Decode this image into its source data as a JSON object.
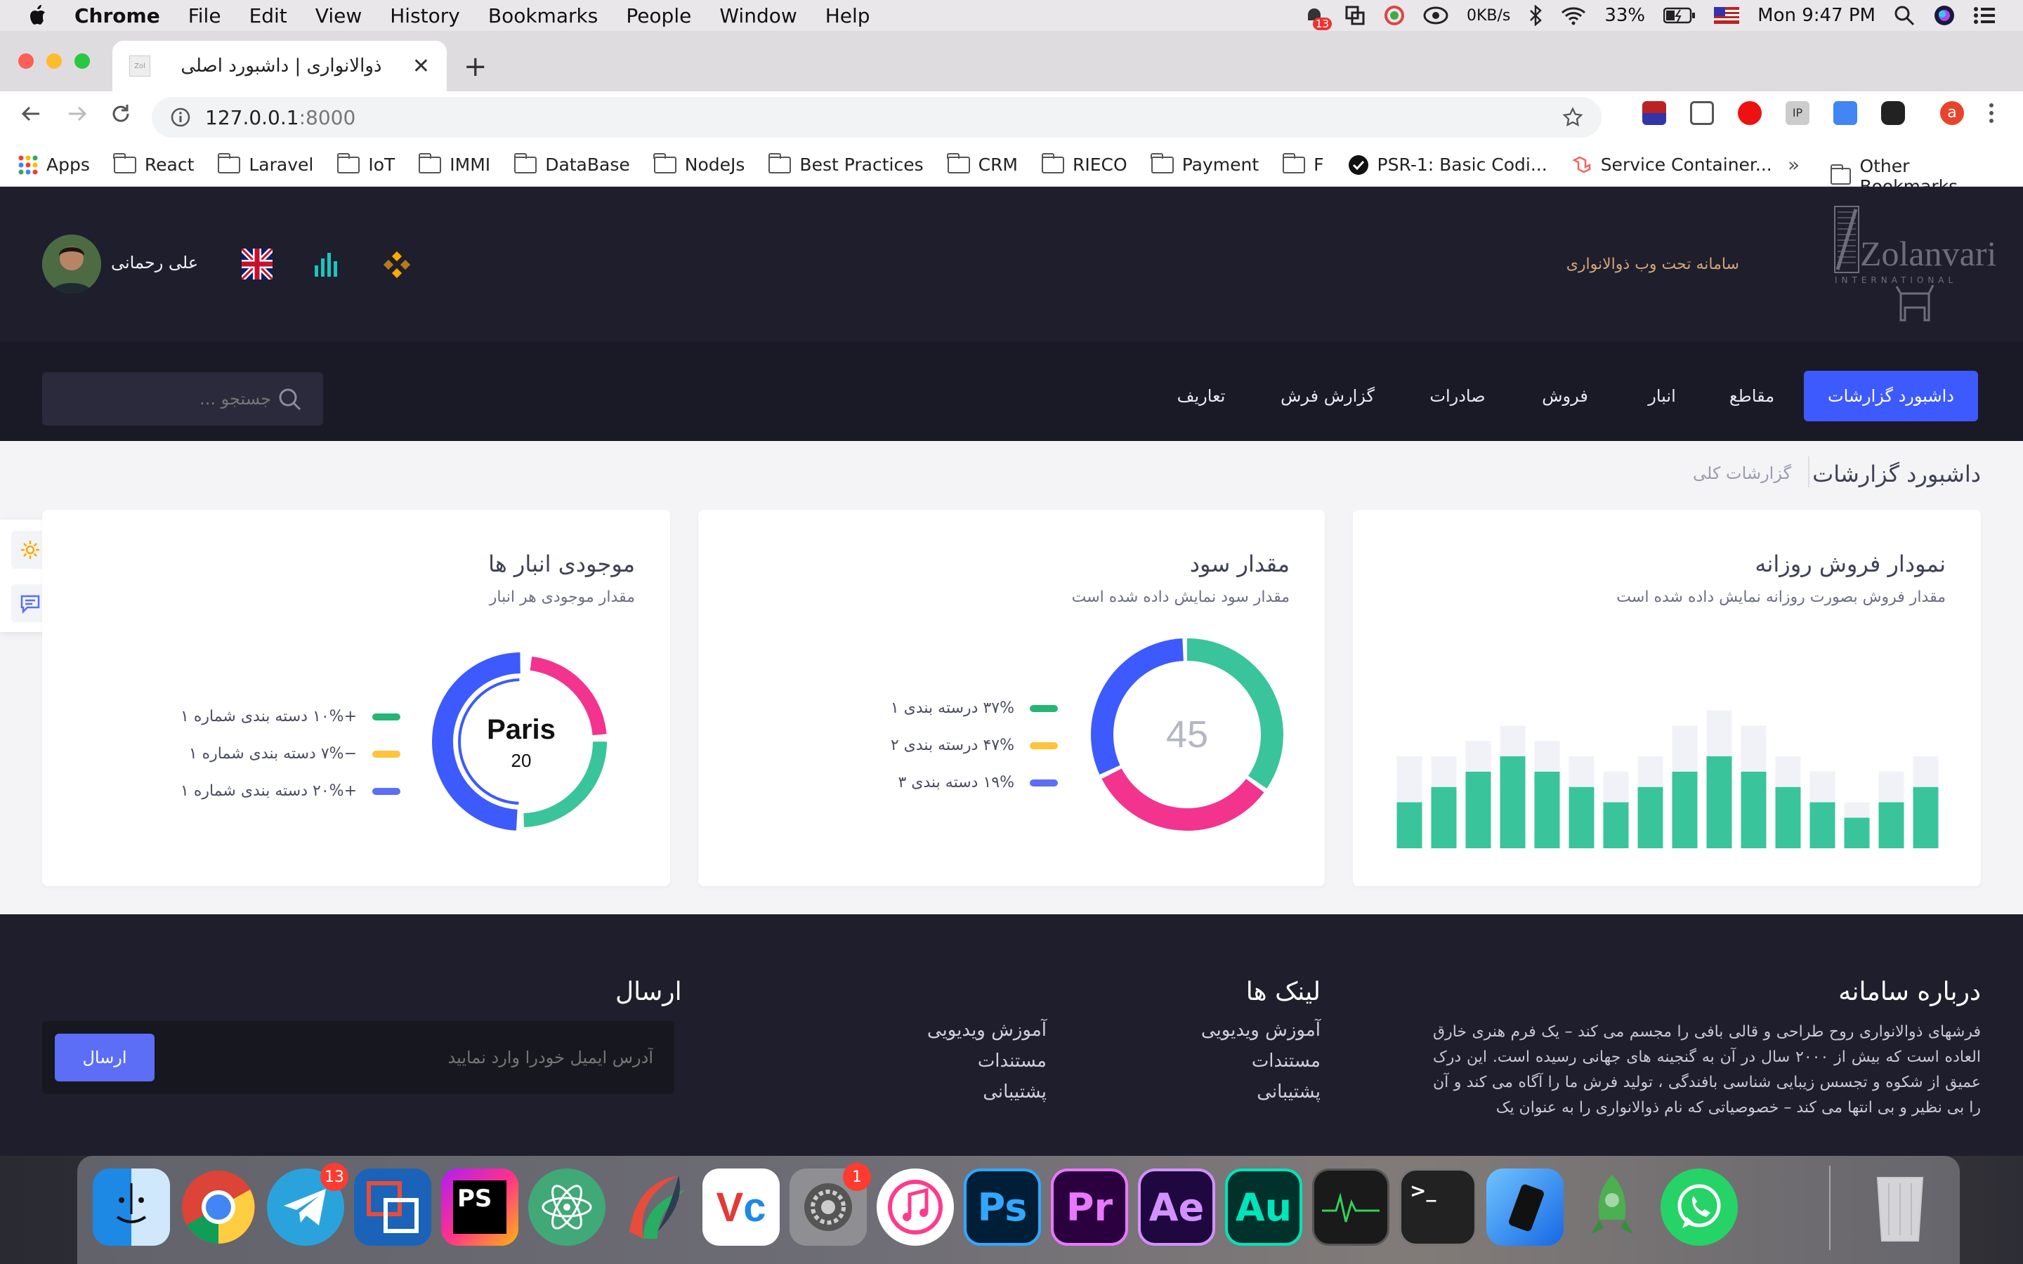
{
  "menubar": {
    "app": "Chrome",
    "items": [
      "File",
      "Edit",
      "View",
      "History",
      "Bookmarks",
      "People",
      "Window",
      "Help"
    ],
    "notif_badge": "13",
    "net_speed": "0KB/s",
    "battery": "33%",
    "clock": "Mon 9:47 PM"
  },
  "browser": {
    "tab_title": "ذوالانواری | داشبورد اصلی",
    "favicon_text": "Zol",
    "url_host": "127.0.0.1",
    "url_port": ":8000",
    "profile_initial": "a",
    "bookmarks": [
      "Apps",
      "React",
      "Laravel",
      "IoT",
      "IMMI",
      "DataBase",
      "NodeJs",
      "Best Practices",
      "CRM",
      "RIECO",
      "Payment",
      "F",
      "PSR-1: Basic Codi...",
      "Service Container...",
      "»",
      "Other Bookmarks"
    ]
  },
  "header": {
    "brand_logo": "Zolanvari",
    "brand_sub": "INTERNATIONAL",
    "tagline": "سامانه تحت وب ذوالانواری",
    "user_name": "علی رحمانی"
  },
  "nav": {
    "items": [
      "داشبورد گزارشات",
      "مقاطع",
      "انبار",
      "فروش",
      "صادرات",
      "گزارش فرش",
      "تعاریف"
    ],
    "search_placeholder": "جستجو ..."
  },
  "breadcrumb": {
    "title": "داشبورد گزارشات",
    "sub": "گزارشات کلی"
  },
  "cards": {
    "sales": {
      "title": "نمودار فروش روزانه",
      "subtitle": "مقدار فروش بصورت روزانه نمایش داده شده است"
    },
    "profit": {
      "title": "مقدار سود",
      "subtitle": "مقدار سود نمایش داده شده است",
      "center": "45",
      "legend": [
        "۳۷% درسته بندی ۱",
        "۴۷% درسته بندی ۲",
        "۱۹% دسته بندی ۳"
      ]
    },
    "stock": {
      "title": "موجودی انبار ها",
      "subtitle": "مقدار موجودی هر انبار",
      "center_city": "Paris",
      "center_value": "20",
      "legend": [
        "+۱۰% دسته بندی شماره ۱",
        "−۷% دسته بندی شماره ۱",
        "+۲۰% دسته بندی شماره ۱"
      ]
    }
  },
  "footer": {
    "about_title": "درباره سامانه",
    "about_text": "فرشهای ذوالانواری روح طراحی و قالی بافی را مجسم می کند – یک فرم هنری خارق العاده است که بیش از ۲۰۰۰ سال در آن به گنجینه های جهانی رسیده است. این درک عمیق از شکوه و تجسس زیبایی شناسی بافندگی ، تولید فرش ما را آگاه می کند و آن را بی نظیر و بی انتها می کند – خصوصیاتی که نام ذوالانواری را به عنوان یک",
    "links_title": "لینک ها",
    "links1": [
      "آموزش ویدیویی",
      "مستندات",
      "پشتیبانی"
    ],
    "links2": [
      "آموزش ویدیویی",
      "مستندات",
      "پشتیبانی"
    ],
    "send_title": "ارسال",
    "email_placeholder": "آدرس ایمیل خودرا وارد نمایید",
    "send_button": "ارسال"
  },
  "dock": {
    "telegram_badge": "13",
    "prefs_badge": "1",
    "apps": [
      "Finder",
      "Chrome",
      "Telegram",
      "Parallels",
      "PhpStorm",
      "Atom",
      "Rocket",
      "VNC",
      "System Preferences",
      "iTunes",
      "Ps",
      "Pr",
      "Ae",
      "Au",
      "Activity Monitor",
      "Terminal",
      "Simulator",
      "Mining",
      "WhatsApp",
      "Trash"
    ]
  },
  "colors": {
    "accent": "#3d5afe",
    "teal": "#3ac49b",
    "pink": "#f2348f",
    "yellow": "#ffc43b",
    "blue": "#5b6ef5",
    "green": "#25b575",
    "header_bg": "#1e1e2d"
  },
  "chart_data": {
    "type": "bar",
    "title": "نمودار فروش روزانه",
    "series": [
      {
        "values": [
          3,
          4,
          5,
          6,
          5,
          4,
          3,
          4,
          5,
          6,
          5,
          4,
          3,
          2,
          3,
          4
        ]
      },
      {
        "values": [
          3,
          2,
          2,
          2,
          2,
          2,
          2,
          2,
          3,
          3,
          3,
          2,
          2,
          1,
          2,
          2
        ]
      }
    ],
    "ylim": [
      0,
      12
    ]
  }
}
